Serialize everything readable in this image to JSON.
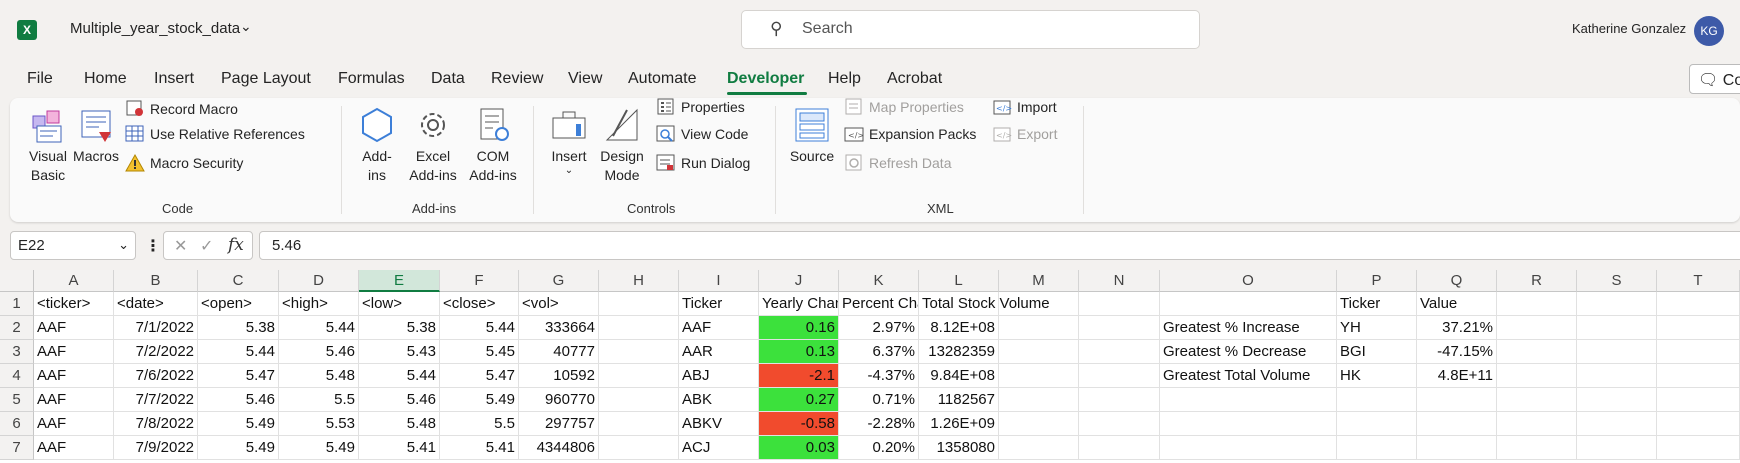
{
  "app": {
    "logo_letter": "X",
    "doc_title": "Multiple_year_stock_data",
    "search_placeholder": "Search",
    "user_name": "Katherine Gonzalez",
    "user_initials": "KG"
  },
  "tabs": [
    "File",
    "Home",
    "Insert",
    "Page Layout",
    "Formulas",
    "Data",
    "Review",
    "View",
    "Automate",
    "Developer",
    "Help",
    "Acrobat"
  ],
  "active_tab": "Developer",
  "comments_button": "Comments",
  "ribbon": {
    "code": {
      "label": "Code",
      "visual_basic": "Visual\nBasic",
      "macros": "Macros",
      "record_macro": "Record Macro",
      "use_relative": "Use Relative References",
      "macro_security": "Macro Security"
    },
    "addins": {
      "label": "Add-ins",
      "addins": "Add-\nins",
      "excel_addins": "Excel\nAdd-ins",
      "com_addins": "COM\nAdd-ins"
    },
    "controls": {
      "label": "Controls",
      "insert": "Insert",
      "design_mode": "Design\nMode",
      "properties": "Properties",
      "view_code": "View Code",
      "run_dialog": "Run Dialog"
    },
    "xml": {
      "label": "XML",
      "source": "Source",
      "map_properties": "Map Properties",
      "expansion_packs": "Expansion Packs",
      "refresh_data": "Refresh Data",
      "import": "Import",
      "export": "Export"
    }
  },
  "formula_bar": {
    "name_box": "E22",
    "formula": "5.46"
  },
  "sheet": {
    "columns": [
      "A",
      "B",
      "C",
      "D",
      "E",
      "F",
      "G",
      "H",
      "I",
      "J",
      "K",
      "L",
      "M",
      "N",
      "O",
      "P",
      "Q",
      "R",
      "S",
      "T"
    ],
    "selected_column": "E",
    "row_numbers": [
      "1",
      "2",
      "3",
      "4",
      "5",
      "6",
      "7"
    ],
    "data_headers": [
      "<ticker>",
      "<date>",
      "<open>",
      "<high>",
      "<low>",
      "<close>",
      "<vol>"
    ],
    "data_rows": [
      [
        "AAF",
        "7/1/2022",
        "5.38",
        "5.44",
        "5.38",
        "5.44",
        "333664"
      ],
      [
        "AAF",
        "7/2/2022",
        "5.44",
        "5.46",
        "5.43",
        "5.45",
        "40777"
      ],
      [
        "AAF",
        "7/6/2022",
        "5.47",
        "5.48",
        "5.44",
        "5.47",
        "10592"
      ],
      [
        "AAF",
        "7/7/2022",
        "5.46",
        "5.5",
        "5.46",
        "5.49",
        "960770"
      ],
      [
        "AAF",
        "7/8/2022",
        "5.49",
        "5.53",
        "5.48",
        "5.5",
        "297757"
      ],
      [
        "AAF",
        "7/9/2022",
        "5.49",
        "5.49",
        "5.41",
        "5.41",
        "4344806"
      ]
    ],
    "summary_headers": [
      "Ticker",
      "Yearly Change",
      "Percent Change",
      "Total Stock Volume"
    ],
    "summary_rows": [
      {
        "ticker": "AAF",
        "change": "0.16",
        "status": "positive",
        "percent": "2.97%",
        "volume": "8.12E+08"
      },
      {
        "ticker": "AAR",
        "change": "0.13",
        "status": "positive",
        "percent": "6.37%",
        "volume": "13282359"
      },
      {
        "ticker": "ABJ",
        "change": "-2.1",
        "status": "negative",
        "percent": "-4.37%",
        "volume": "9.84E+08"
      },
      {
        "ticker": "ABK",
        "change": "0.27",
        "status": "positive",
        "percent": "0.71%",
        "volume": "1182567"
      },
      {
        "ticker": "ABKV",
        "change": "-0.58",
        "status": "negative",
        "percent": "-2.28%",
        "volume": "1.26E+09"
      },
      {
        "ticker": "ACJ",
        "change": "0.03",
        "status": "positive",
        "percent": "0.20%",
        "volume": "1358080"
      }
    ],
    "greatest_headers": [
      "Ticker",
      "Value"
    ],
    "greatest_rows": [
      {
        "label": "Greatest % Increase",
        "ticker": "YH",
        "value": "37.21%"
      },
      {
        "label": "Greatest % Decrease",
        "ticker": "BGI",
        "value": "-47.15%"
      },
      {
        "label": "Greatest Total Volume",
        "ticker": "HK",
        "value": "4.8E+11"
      }
    ]
  },
  "colors": {
    "brand": "#107c41",
    "positive": "#3ce13c",
    "negative": "#f14b2d"
  }
}
